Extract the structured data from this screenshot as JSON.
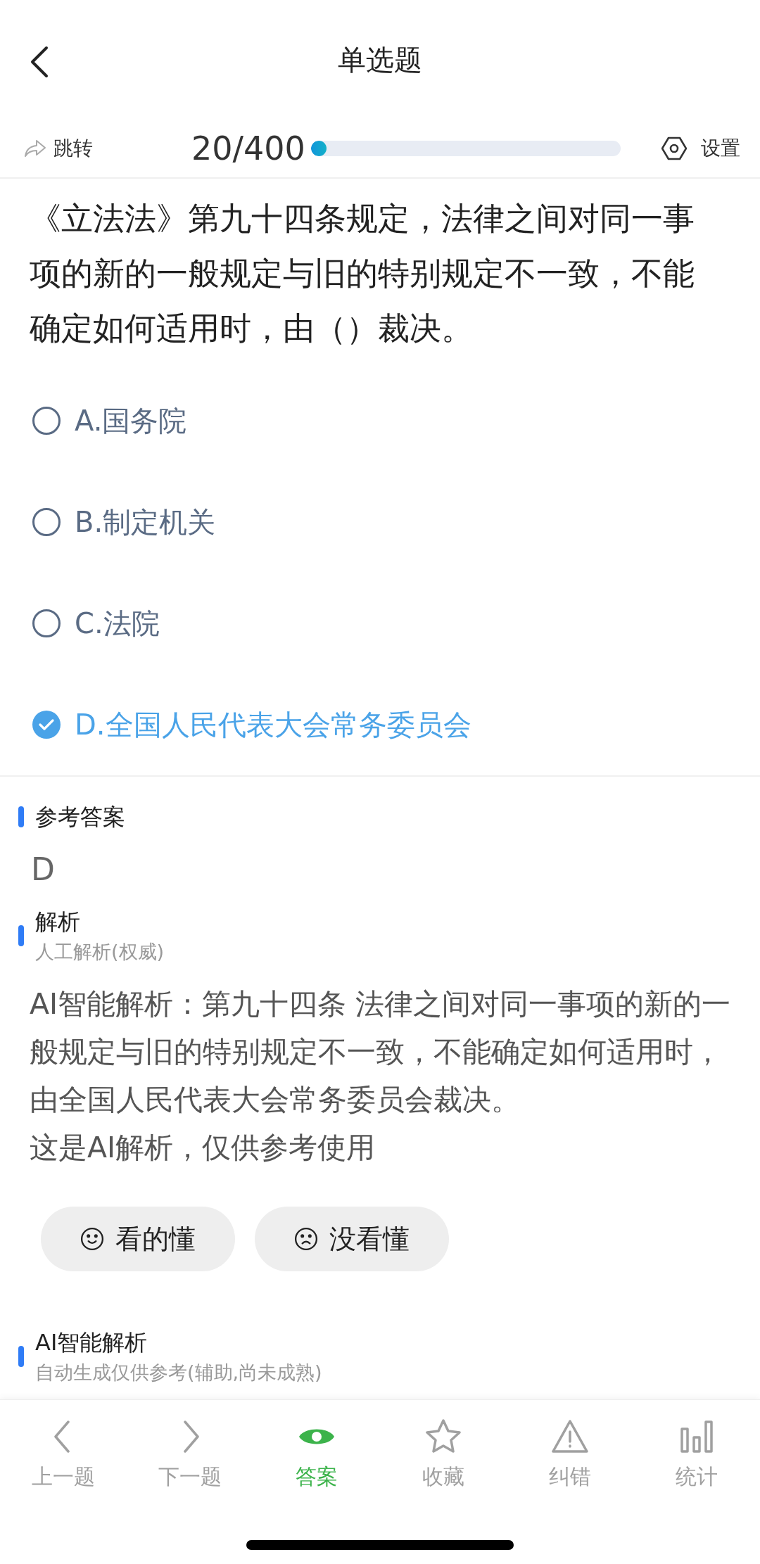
{
  "header": {
    "title": "单选题"
  },
  "progress": {
    "jump_label": "跳转",
    "count": "20/400",
    "level": 0.05,
    "settings_label": "设置"
  },
  "question": {
    "text": "《立法法》第九十四条规定，法律之间对同一事项的新的一般规定与旧的特别规定不一致，不能确定如何适用时，由（）裁决。",
    "options": [
      {
        "label": "A.国务院",
        "selected": false
      },
      {
        "label": "B.制定机关",
        "selected": false
      },
      {
        "label": "C.法院",
        "selected": false
      },
      {
        "label": "D.全国人民代表大会常务委员会",
        "selected": true
      }
    ]
  },
  "answer": {
    "heading": "参考答案",
    "value": "D"
  },
  "analysis": {
    "heading": "解析",
    "subheading": "人工解析(权威)",
    "text": "AI智能解析：第九十四条 法律之间对同一事项的新的一般规定与旧的特别规定不一致，不能确定如何适用时，由全国人民代表大会常务委员会裁决。",
    "note": "这是AI解析，仅供参考使用",
    "feedback": [
      {
        "kind": "happy",
        "label": "看的懂"
      },
      {
        "kind": "sad",
        "label": "没看懂"
      }
    ]
  },
  "ai_analysis": {
    "heading": "AI智能解析",
    "subheading": "自动生成仅供参考(辅助,尚未成熟)"
  },
  "tab_bar": [
    {
      "kind": "prev",
      "label": "上一题",
      "selected": false
    },
    {
      "kind": "next",
      "label": "下一题",
      "selected": false
    },
    {
      "kind": "answer",
      "label": "答案",
      "selected": true
    },
    {
      "kind": "favorite",
      "label": "收藏",
      "selected": false
    },
    {
      "kind": "report",
      "label": "纠错",
      "selected": false
    },
    {
      "kind": "stats",
      "label": "统计",
      "selected": false
    }
  ]
}
